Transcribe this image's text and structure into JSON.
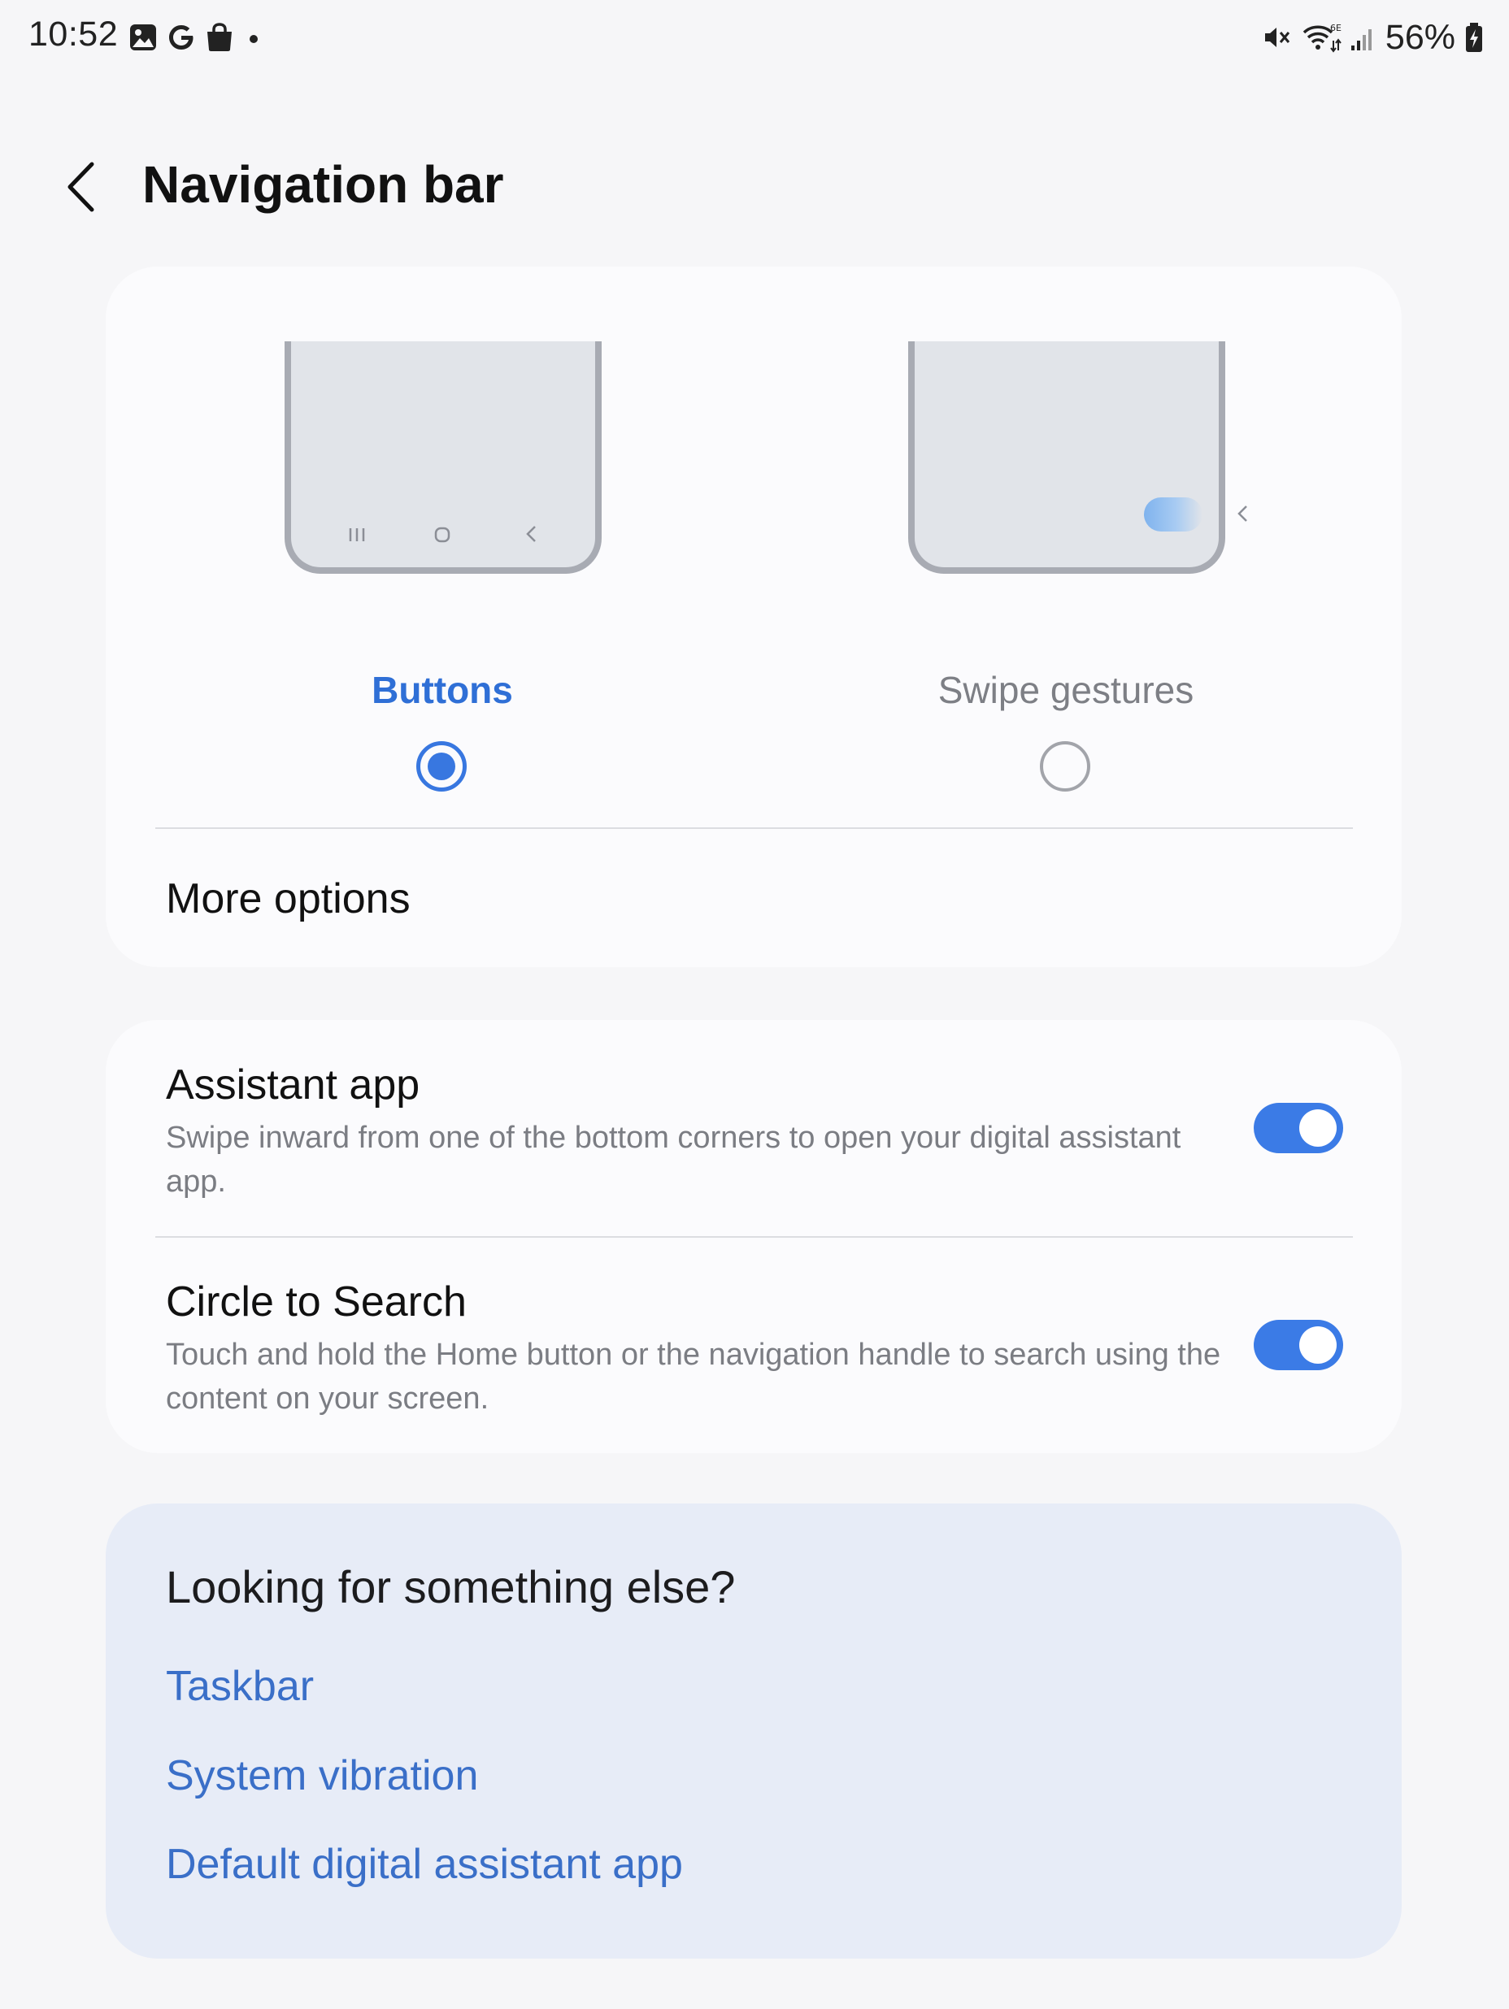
{
  "status_bar": {
    "time": "10:52",
    "battery_percent": "56%",
    "left_icons": [
      "gallery-icon",
      "google-icon",
      "shopping-bag-icon",
      "notification-dot-icon"
    ],
    "right_icons": [
      "mute-icon",
      "wifi-6e-icon",
      "cellular-signal-icon",
      "battery-charging-icon"
    ]
  },
  "header": {
    "title": "Navigation bar"
  },
  "navigation_type": {
    "options": [
      {
        "label": "Buttons",
        "selected": true
      },
      {
        "label": "Swipe gestures",
        "selected": false
      }
    ],
    "more_options_label": "More options"
  },
  "settings": {
    "assistant_app": {
      "title": "Assistant app",
      "description": "Swipe inward from one of the bottom corners to open your digital assistant app.",
      "enabled": true
    },
    "circle_to_search": {
      "title": "Circle to Search",
      "description": "Touch and hold the Home button or the navigation handle to search using the content on your screen.",
      "enabled": true
    }
  },
  "looking_for": {
    "title": "Looking for something else?",
    "links": [
      "Taskbar",
      "System vibration",
      "Default digital assistant app"
    ]
  },
  "colors": {
    "accent": "#3877e0",
    "background": "#f6f6f8",
    "card": "#fbfbfd",
    "suggestion_card": "#e7ecf7",
    "link": "#3a6fc8"
  }
}
